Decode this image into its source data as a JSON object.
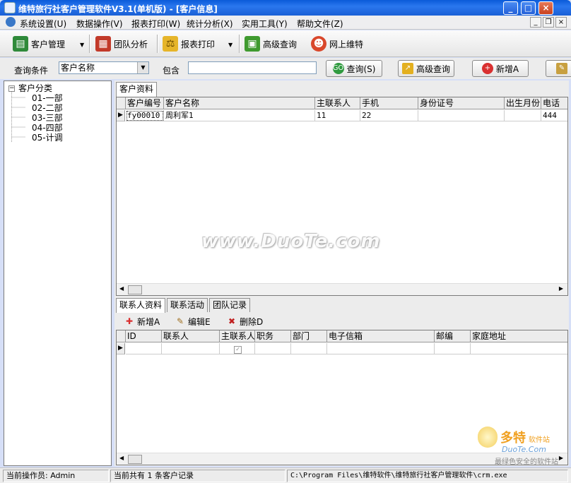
{
  "window": {
    "title": "维特旅行社客户管理软件V3.1(单机版) - [客户信息]"
  },
  "menu": [
    "系统设置(U)",
    "数据操作(V)",
    "报表打印(W)",
    "统计分析(X)",
    "实用工具(Y)",
    "帮助文件(Z)"
  ],
  "toolbar": {
    "customer_mgmt": "客户管理",
    "team_analysis": "团队分析",
    "report_print": "报表打印",
    "advanced_query": "高级查询",
    "online_maint": "网上维特"
  },
  "query": {
    "condition_label": "查询条件",
    "field_value": "客户名称",
    "contains_label": "包含",
    "search_button": "查询(S)",
    "advanced_button": "高级查询",
    "add_button": "新增A"
  },
  "tree": {
    "root": "客户分类",
    "children": [
      "01-一部",
      "02-二部",
      "03-三部",
      "04-四部",
      "05-计调"
    ]
  },
  "customer_tab": "客户资料",
  "customer_grid": {
    "columns": [
      "客户编号",
      "客户名称",
      "主联系人",
      "手机",
      "身份证号",
      "出生月份",
      "电话"
    ],
    "rows": [
      [
        "fy00010",
        "周利军1",
        "11",
        "22",
        "",
        "",
        "444"
      ]
    ]
  },
  "bottom_tabs": [
    "联系人资料",
    "联系活动",
    "团队记录"
  ],
  "contact_actions": {
    "add": "新增A",
    "edit": "编辑E",
    "delete": "删除D"
  },
  "contact_grid": {
    "columns": [
      "ID",
      "联系人",
      "主联系人",
      "职务",
      "部门",
      "电子信箱",
      "邮编",
      "家庭地址"
    ]
  },
  "watermark": "www.DuoTe.com",
  "logo": {
    "line1": "多特",
    "line2": "软件站",
    "line3": "DuoTe.Com",
    "line4": "最绿色安全的软件站"
  },
  "status": {
    "operator": "当前操作员: Admin",
    "record_count": "当前共有 1 条客户记录",
    "path": "C:\\Program Files\\维特软件\\维特旅行社客户管理软件\\crm.exe"
  }
}
